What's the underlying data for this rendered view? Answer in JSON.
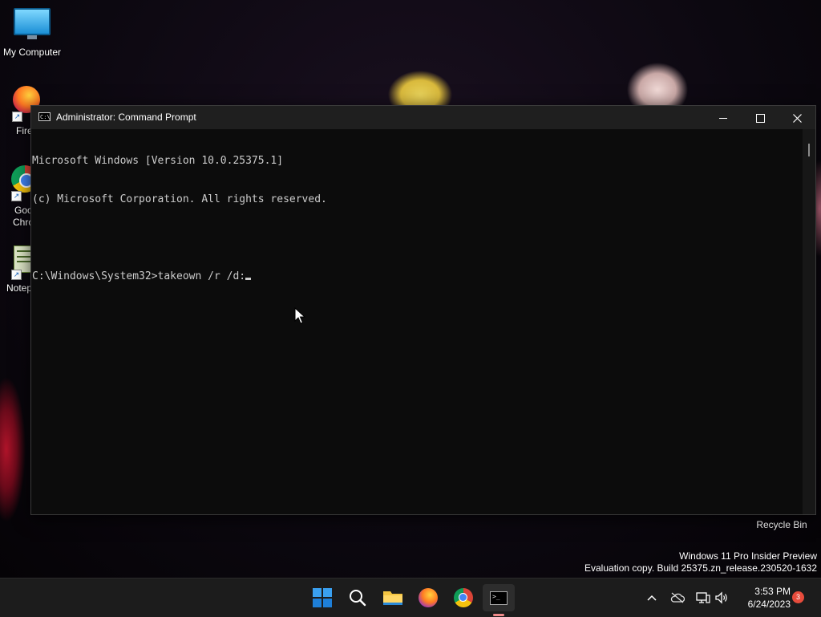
{
  "desktop": {
    "icons": [
      {
        "label": "My Computer"
      },
      {
        "label": "Fire"
      },
      {
        "label_line1": "Goo",
        "label_line2": "Chro"
      },
      {
        "label": "Notep"
      }
    ],
    "recycle_bin": "Recycle Bin",
    "watermark": {
      "line1": "Windows 11 Pro Insider Preview",
      "line2": "Evaluation copy. Build 25375.zn_release.230520-1632"
    }
  },
  "cmd_window": {
    "title": "Administrator: Command Prompt",
    "lines": [
      "Microsoft Windows [Version 10.0.25375.1]",
      "(c) Microsoft Corporation. All rights reserved.",
      "",
      "C:\\Windows\\System32>takeown /r /d:"
    ],
    "titlebar_icon_text": "C:\\"
  },
  "taskbar": {
    "apps": [
      "start-icon",
      "search-icon",
      "file-explorer-icon",
      "firefox-icon",
      "chrome-icon",
      "command-prompt-icon"
    ],
    "clock": {
      "time": "3:53 PM",
      "date": "6/24/2023"
    },
    "notification_count": "3"
  },
  "colors": {
    "taskbar_bg": "#1c1c1c",
    "cmd_bg": "#0c0c0c",
    "cmd_text": "#cccccc",
    "badge": "#e74c3c"
  }
}
